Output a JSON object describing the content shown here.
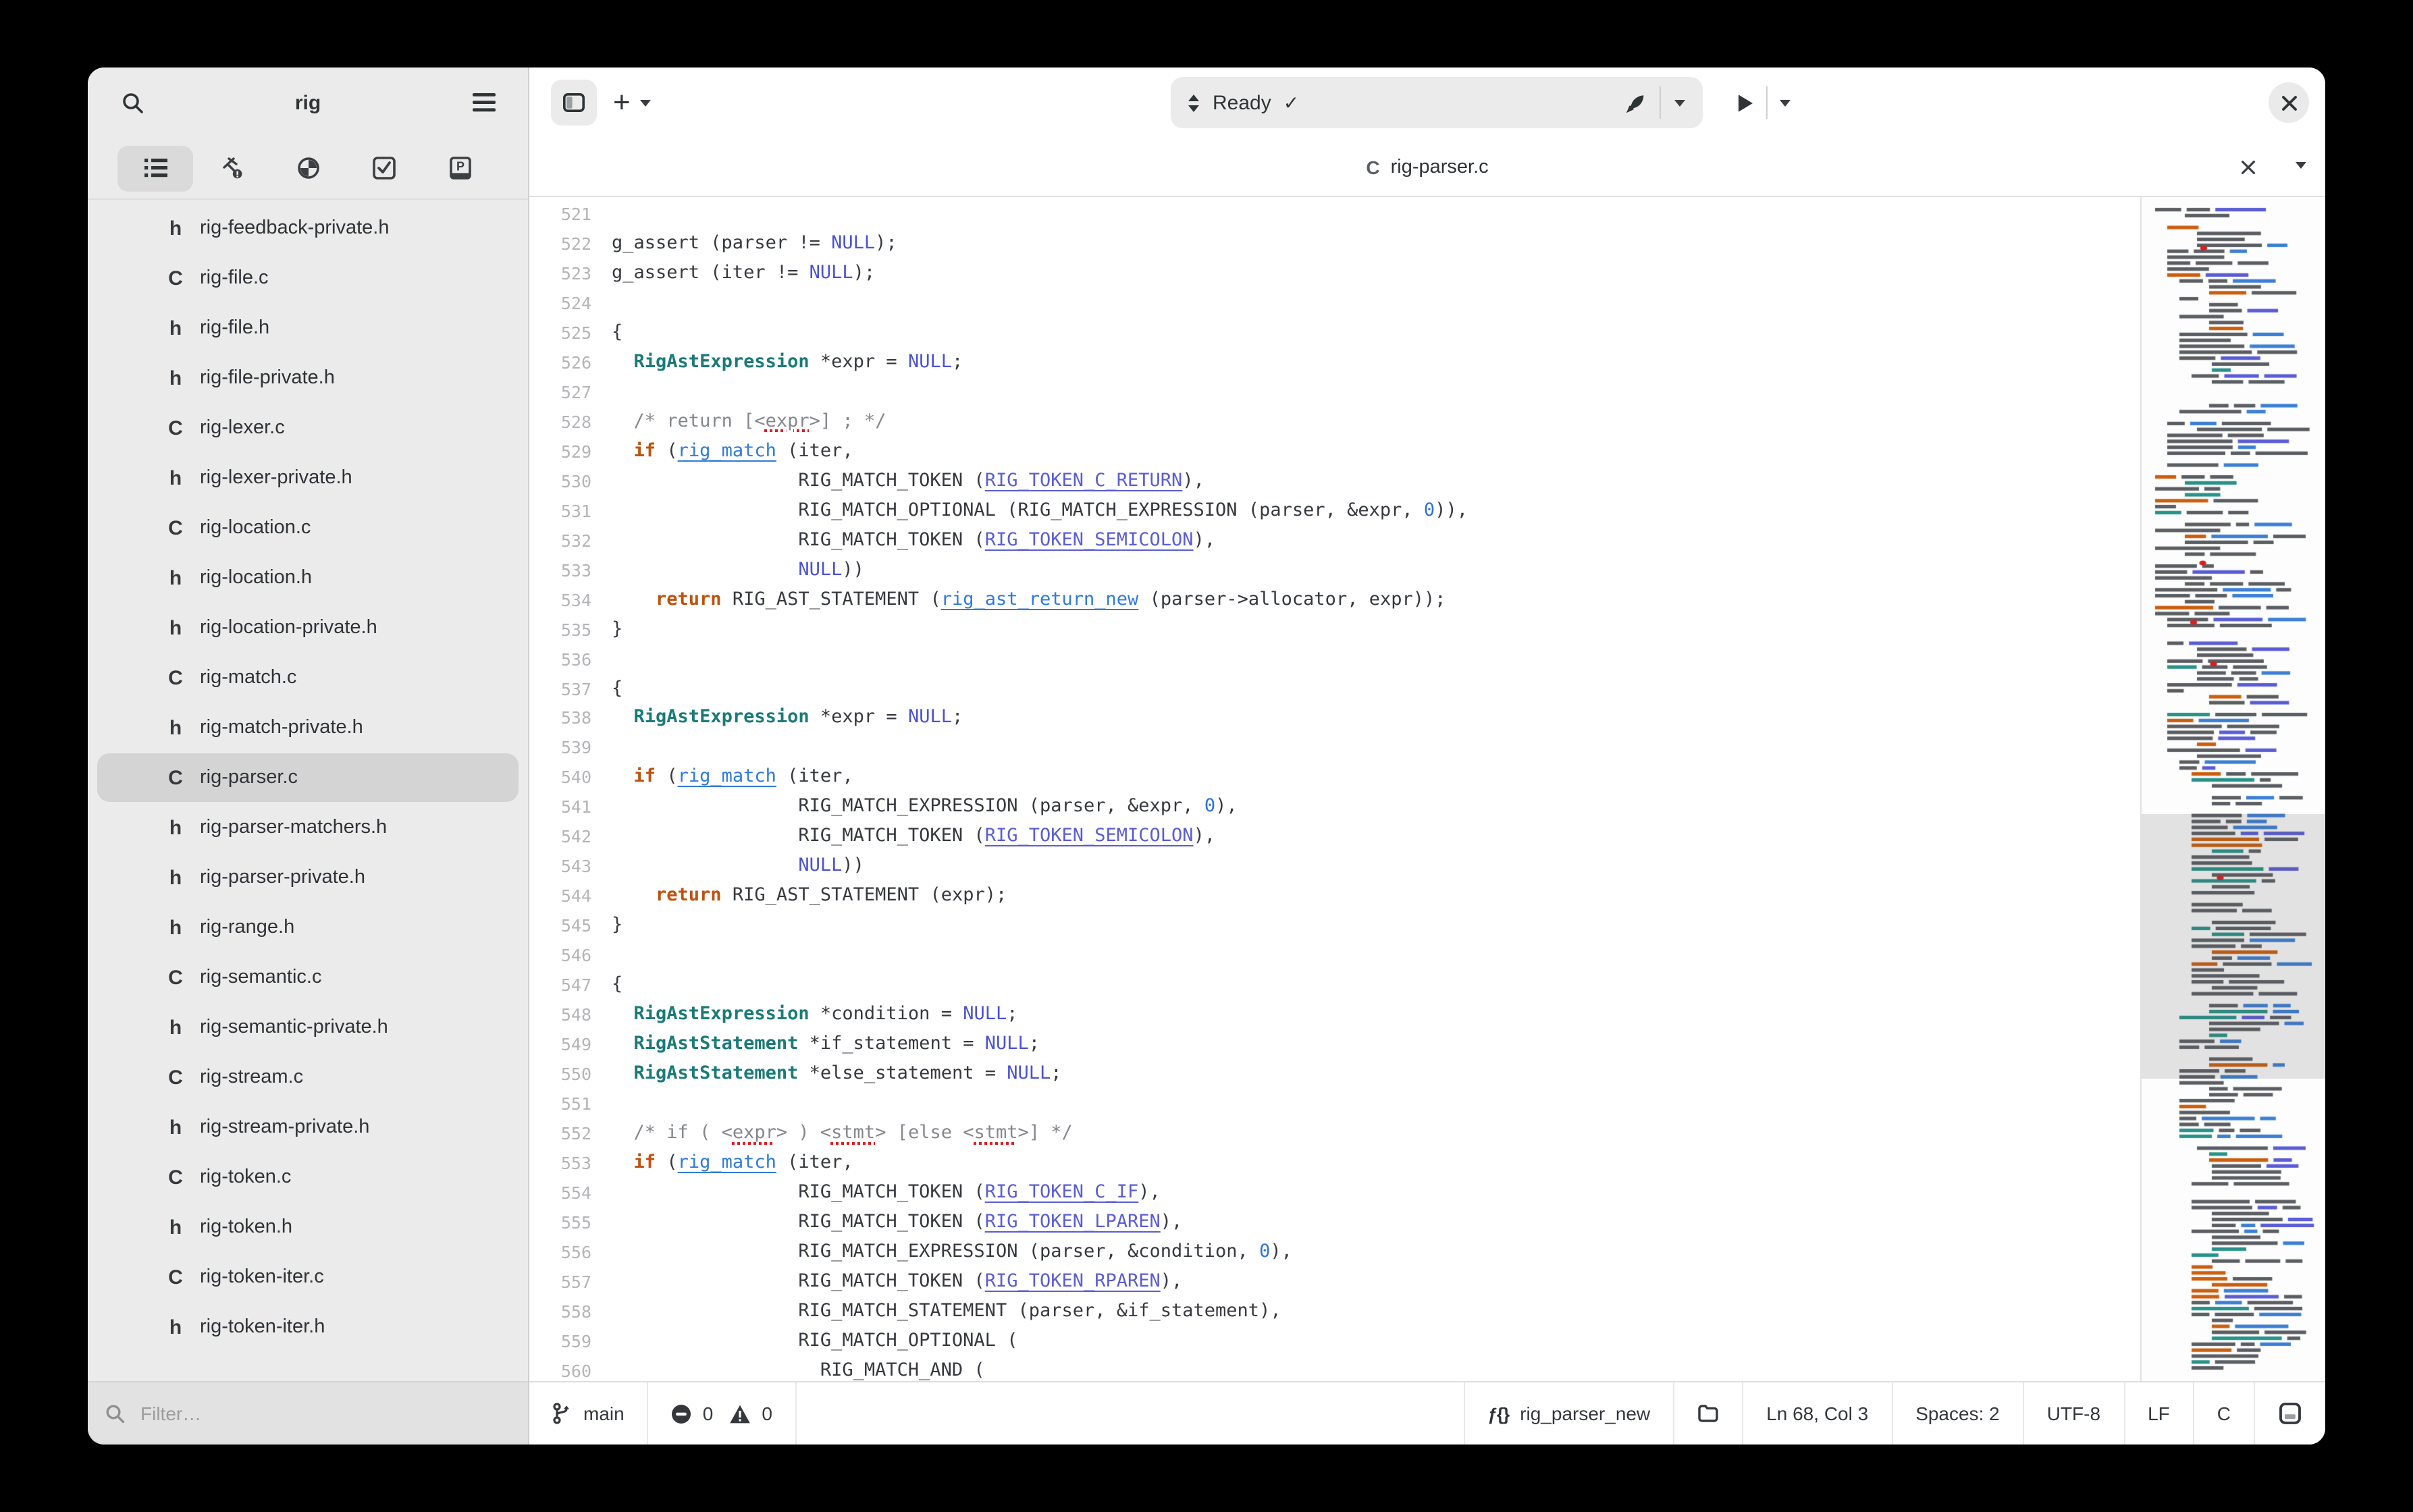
{
  "window": {
    "title": "rig"
  },
  "sidebar": {
    "title": "rig",
    "tabs": [
      {
        "id": "project-tree",
        "selected": true
      },
      {
        "id": "build",
        "selected": false
      },
      {
        "id": "debug",
        "selected": false
      },
      {
        "id": "tests",
        "selected": false
      },
      {
        "id": "documentation",
        "selected": false
      }
    ],
    "files": [
      {
        "badge": "h",
        "name": "rig-feedback-private.h",
        "selected": false
      },
      {
        "badge": "C",
        "name": "rig-file.c",
        "selected": false
      },
      {
        "badge": "h",
        "name": "rig-file.h",
        "selected": false
      },
      {
        "badge": "h",
        "name": "rig-file-private.h",
        "selected": false
      },
      {
        "badge": "C",
        "name": "rig-lexer.c",
        "selected": false
      },
      {
        "badge": "h",
        "name": "rig-lexer-private.h",
        "selected": false
      },
      {
        "badge": "C",
        "name": "rig-location.c",
        "selected": false
      },
      {
        "badge": "h",
        "name": "rig-location.h",
        "selected": false
      },
      {
        "badge": "h",
        "name": "rig-location-private.h",
        "selected": false
      },
      {
        "badge": "C",
        "name": "rig-match.c",
        "selected": false
      },
      {
        "badge": "h",
        "name": "rig-match-private.h",
        "selected": false
      },
      {
        "badge": "C",
        "name": "rig-parser.c",
        "selected": true
      },
      {
        "badge": "h",
        "name": "rig-parser-matchers.h",
        "selected": false
      },
      {
        "badge": "h",
        "name": "rig-parser-private.h",
        "selected": false
      },
      {
        "badge": "h",
        "name": "rig-range.h",
        "selected": false
      },
      {
        "badge": "C",
        "name": "rig-semantic.c",
        "selected": false
      },
      {
        "badge": "h",
        "name": "rig-semantic-private.h",
        "selected": false
      },
      {
        "badge": "C",
        "name": "rig-stream.c",
        "selected": false
      },
      {
        "badge": "h",
        "name": "rig-stream-private.h",
        "selected": false
      },
      {
        "badge": "C",
        "name": "rig-token.c",
        "selected": false
      },
      {
        "badge": "h",
        "name": "rig-token.h",
        "selected": false
      },
      {
        "badge": "C",
        "name": "rig-token-iter.c",
        "selected": false
      },
      {
        "badge": "h",
        "name": "rig-token-iter.h",
        "selected": false
      }
    ],
    "filter_placeholder": "Filter…"
  },
  "header": {
    "status": "Ready",
    "check": "✓",
    "plus": "+",
    "play": "▶"
  },
  "tab": {
    "badge": "C",
    "title": "rig-parser.c"
  },
  "editor": {
    "lines": [
      {
        "n": "521",
        "t": []
      },
      {
        "n": "522",
        "t": [
          [
            "g_assert (parser != ",
            ""
          ],
          [
            "NULL",
            "nl"
          ],
          [
            ");",
            ""
          ]
        ]
      },
      {
        "n": "523",
        "t": [
          [
            "g_assert (iter != ",
            ""
          ],
          [
            "NULL",
            "nl"
          ],
          [
            ");",
            ""
          ]
        ]
      },
      {
        "n": "524",
        "t": []
      },
      {
        "n": "525",
        "t": [
          [
            "{",
            ""
          ]
        ]
      },
      {
        "n": "526",
        "t": [
          [
            "  ",
            ""
          ],
          [
            "RigAstExpression",
            "ty"
          ],
          [
            " *expr = ",
            ""
          ],
          [
            "NULL",
            "nl"
          ],
          [
            ";",
            ""
          ]
        ]
      },
      {
        "n": "527",
        "t": []
      },
      {
        "n": "528",
        "t": [
          [
            "  ",
            ""
          ],
          [
            "/* return [<",
            "cm"
          ],
          [
            "expr",
            "cw"
          ],
          [
            ">] ; */",
            "cm"
          ]
        ]
      },
      {
        "n": "529",
        "t": [
          [
            "  ",
            ""
          ],
          [
            "if",
            "kw"
          ],
          [
            " (",
            ""
          ],
          [
            "rig_match",
            "fn"
          ],
          [
            " (iter,",
            ""
          ]
        ]
      },
      {
        "n": "530",
        "t": [
          [
            "                 RIG_MATCH_TOKEN (",
            ""
          ],
          [
            "RIG_TOKEN_C_RETURN",
            "ctk"
          ],
          [
            "),",
            ""
          ]
        ]
      },
      {
        "n": "531",
        "t": [
          [
            "                 RIG_MATCH_OPTIONAL (RIG_MATCH_EXPRESSION (parser, &expr, ",
            ""
          ],
          [
            "0",
            "nu"
          ],
          [
            ")),",
            ""
          ]
        ]
      },
      {
        "n": "532",
        "t": [
          [
            "                 RIG_MATCH_TOKEN (",
            ""
          ],
          [
            "RIG_TOKEN_SEMICOLON",
            "ctk"
          ],
          [
            "),",
            ""
          ]
        ]
      },
      {
        "n": "533",
        "t": [
          [
            "                 ",
            ""
          ],
          [
            "NULL",
            "nl"
          ],
          [
            "))",
            ""
          ]
        ]
      },
      {
        "n": "534",
        "t": [
          [
            "    ",
            ""
          ],
          [
            "return",
            "kw"
          ],
          [
            " RIG_AST_STATEMENT (",
            ""
          ],
          [
            "rig_ast_return_new",
            "fn"
          ],
          [
            " (parser->allocator, expr));",
            ""
          ]
        ]
      },
      {
        "n": "535",
        "t": [
          [
            "}",
            ""
          ]
        ]
      },
      {
        "n": "536",
        "t": []
      },
      {
        "n": "537",
        "t": [
          [
            "{",
            ""
          ]
        ]
      },
      {
        "n": "538",
        "t": [
          [
            "  ",
            ""
          ],
          [
            "RigAstExpression",
            "ty"
          ],
          [
            " *expr = ",
            ""
          ],
          [
            "NULL",
            "nl"
          ],
          [
            ";",
            ""
          ]
        ]
      },
      {
        "n": "539",
        "t": []
      },
      {
        "n": "540",
        "t": [
          [
            "  ",
            ""
          ],
          [
            "if",
            "kw"
          ],
          [
            " (",
            ""
          ],
          [
            "rig_match",
            "fn"
          ],
          [
            " (iter,",
            ""
          ]
        ]
      },
      {
        "n": "541",
        "t": [
          [
            "                 RIG_MATCH_EXPRESSION (parser, &expr, ",
            ""
          ],
          [
            "0",
            "nu"
          ],
          [
            "),",
            ""
          ]
        ]
      },
      {
        "n": "542",
        "t": [
          [
            "                 RIG_MATCH_TOKEN (",
            ""
          ],
          [
            "RIG_TOKEN_SEMICOLON",
            "ctk"
          ],
          [
            "),",
            ""
          ]
        ]
      },
      {
        "n": "543",
        "t": [
          [
            "                 ",
            ""
          ],
          [
            "NULL",
            "nl"
          ],
          [
            "))",
            ""
          ]
        ]
      },
      {
        "n": "544",
        "t": [
          [
            "    ",
            ""
          ],
          [
            "return",
            "kw"
          ],
          [
            " RIG_AST_STATEMENT (expr);",
            ""
          ]
        ]
      },
      {
        "n": "545",
        "t": [
          [
            "}",
            ""
          ]
        ]
      },
      {
        "n": "546",
        "t": []
      },
      {
        "n": "547",
        "t": [
          [
            "{",
            ""
          ]
        ]
      },
      {
        "n": "548",
        "t": [
          [
            "  ",
            ""
          ],
          [
            "RigAstExpression",
            "ty"
          ],
          [
            " *condition = ",
            ""
          ],
          [
            "NULL",
            "nl"
          ],
          [
            ";",
            ""
          ]
        ]
      },
      {
        "n": "549",
        "t": [
          [
            "  ",
            ""
          ],
          [
            "RigAstStatement",
            "ty"
          ],
          [
            " *if_statement = ",
            ""
          ],
          [
            "NULL",
            "nl"
          ],
          [
            ";",
            ""
          ]
        ]
      },
      {
        "n": "550",
        "t": [
          [
            "  ",
            ""
          ],
          [
            "RigAstStatement",
            "ty"
          ],
          [
            " *else_statement = ",
            ""
          ],
          [
            "NULL",
            "nl"
          ],
          [
            ";",
            ""
          ]
        ]
      },
      {
        "n": "551",
        "t": []
      },
      {
        "n": "552",
        "t": [
          [
            "  ",
            ""
          ],
          [
            "/* if ( <",
            "cm"
          ],
          [
            "expr",
            "cw"
          ],
          [
            "> ) <",
            "cm"
          ],
          [
            "stmt",
            "cw"
          ],
          [
            "> [else <",
            "cm"
          ],
          [
            "stmt",
            "cw"
          ],
          [
            ">] */",
            "cm"
          ]
        ]
      },
      {
        "n": "553",
        "t": [
          [
            "  ",
            ""
          ],
          [
            "if",
            "kw"
          ],
          [
            " (",
            ""
          ],
          [
            "rig_match",
            "fn"
          ],
          [
            " (iter,",
            ""
          ]
        ]
      },
      {
        "n": "554",
        "t": [
          [
            "                 RIG_MATCH_TOKEN (",
            ""
          ],
          [
            "RIG_TOKEN_C_IF",
            "ctk"
          ],
          [
            "),",
            ""
          ]
        ]
      },
      {
        "n": "555",
        "t": [
          [
            "                 RIG_MATCH_TOKEN (",
            ""
          ],
          [
            "RIG_TOKEN_LPAREN",
            "ctk"
          ],
          [
            "),",
            ""
          ]
        ]
      },
      {
        "n": "556",
        "t": [
          [
            "                 RIG_MATCH_EXPRESSION (parser, &condition, ",
            ""
          ],
          [
            "0",
            "nu"
          ],
          [
            "),",
            ""
          ]
        ]
      },
      {
        "n": "557",
        "t": [
          [
            "                 RIG_MATCH_TOKEN (",
            ""
          ],
          [
            "RIG_TOKEN_RPAREN",
            "ctk"
          ],
          [
            "),",
            ""
          ]
        ]
      },
      {
        "n": "558",
        "t": [
          [
            "                 RIG_MATCH_STATEMENT (parser, &if_statement),",
            ""
          ]
        ]
      },
      {
        "n": "559",
        "t": [
          [
            "                 RIG_MATCH_OPTIONAL (",
            ""
          ]
        ]
      },
      {
        "n": "560",
        "t": [
          [
            "                   RIG_MATCH_AND (",
            ""
          ]
        ]
      }
    ],
    "syntax_colors": {
      "keyword": "#bf520e",
      "function": "#2f7bd9",
      "constant": "#5a5dd4",
      "null": "#4a52d4",
      "number": "#2f72d8",
      "type": "#1a7b78",
      "comment": "#84878c",
      "plain": "#36393f",
      "line_number": "#b4b5b8",
      "spellcheck": "#e01b24"
    }
  },
  "minimap": {
    "palette": {
      "dark": "#5a5e63",
      "blue": "#3b7fd4",
      "indigo": "#5a5cd5",
      "orange": "#cb5e0e",
      "teal": "#279288",
      "error": "#d62020"
    }
  },
  "statusbar": {
    "branch": "main",
    "errors": "0",
    "warnings": "0",
    "symbol_icon": "ƒ{}",
    "symbol": "rig_parser_new",
    "position": "Ln 68, Col 3",
    "spaces": "Spaces: 2",
    "encoding": "UTF-8",
    "line_ending": "LF",
    "language": "C"
  }
}
